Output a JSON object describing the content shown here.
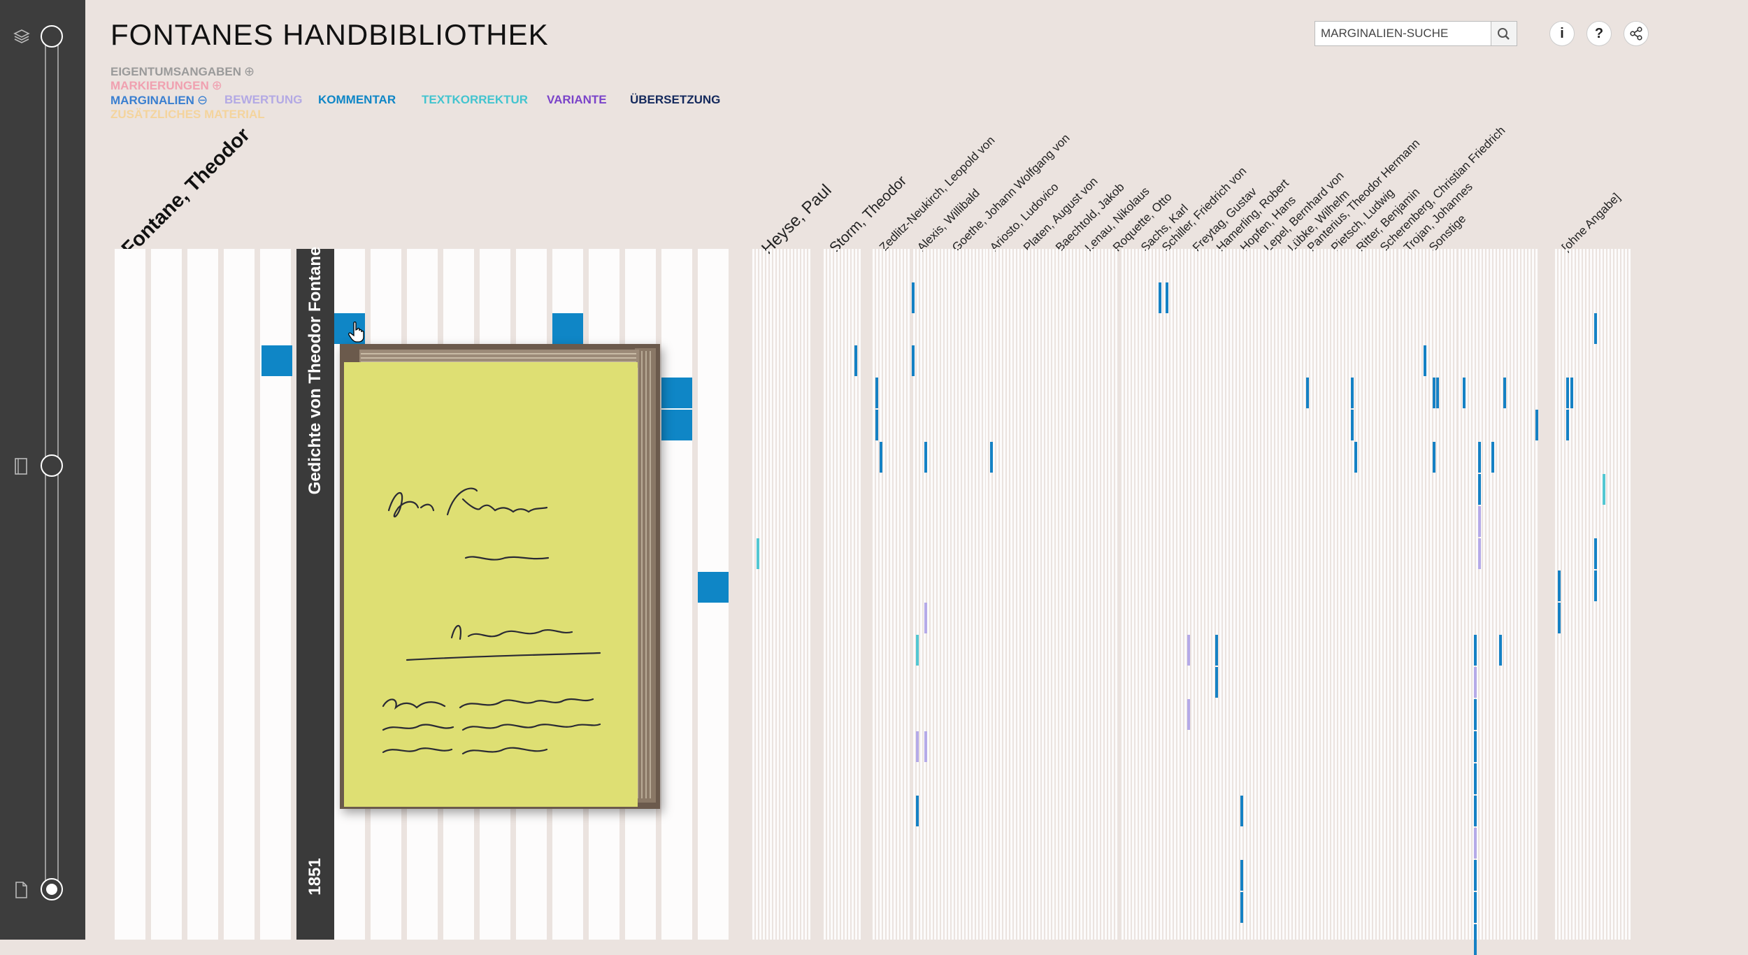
{
  "app": {
    "title": "FONTANES HANDBIBLIOTHEK"
  },
  "legend": [
    {
      "label": "EIGENTUMSANGABEN",
      "color": "#9a9a9a",
      "toggle": "⊕"
    },
    {
      "label": "MARKIERUNGEN",
      "color": "#f0a0b0",
      "toggle": "⊕"
    },
    {
      "label": "MARGINALIEN",
      "color": "#3a7fd0",
      "toggle": "⊖"
    },
    {
      "label": "BEWERTUNG",
      "color": "#b3a9e4"
    },
    {
      "label": "KOMMENTAR",
      "color": "#0f86c6"
    },
    {
      "label": "TEXTKORREKTUR",
      "color": "#43c4cf"
    },
    {
      "label": "VARIANTE",
      "color": "#7a43c9"
    },
    {
      "label": "ÜBERSETZUNG",
      "color": "#14295c"
    },
    {
      "label": "ZUSÄTZLICHES MATERIAL",
      "color": "#f4d49d"
    }
  ],
  "search": {
    "placeholder": "MARGINALIEN-SUCHE",
    "icon": "search-icon"
  },
  "header_buttons": [
    {
      "name": "info-button",
      "label": "i"
    },
    {
      "name": "help-button",
      "label": "?"
    },
    {
      "name": "share-button",
      "icon": "share-icon"
    }
  ],
  "sidebar": {
    "icons": [
      "library-icon",
      "book-icon",
      "page-icon"
    ]
  },
  "owner": "Fontane, Theodor",
  "featured_book": {
    "title": "Gedichte von Theodor Fontane",
    "year": "1851"
  },
  "persons": [
    "Heyse, Paul",
    "Storm, Theodor",
    "Zedlitz-Neukirch, Leopold von",
    "Alexis, Willibald",
    "Goethe, Johann Wolfgang von",
    "Ariosto, Ludovico",
    "Platen, August von",
    "Baechtold, Jakob",
    "Lenau, Nikolaus",
    "Roquette, Otto",
    "Sachs, Karl",
    "Schiller, Friedrich von",
    "Freytag, Gustav",
    "Hamerling, Robert",
    "Hopfen, Hans",
    "Lepel, Bernhard von",
    "Lübke, Wilhelm",
    "Panterius, Theodor Hermann",
    "Pietsch, Ludwig",
    "Ritter, Benjamin",
    "Scherenberg, Christian Friedrich",
    "Trojan, Johannes",
    "Sonstige",
    "[ohne Angabe]"
  ]
}
